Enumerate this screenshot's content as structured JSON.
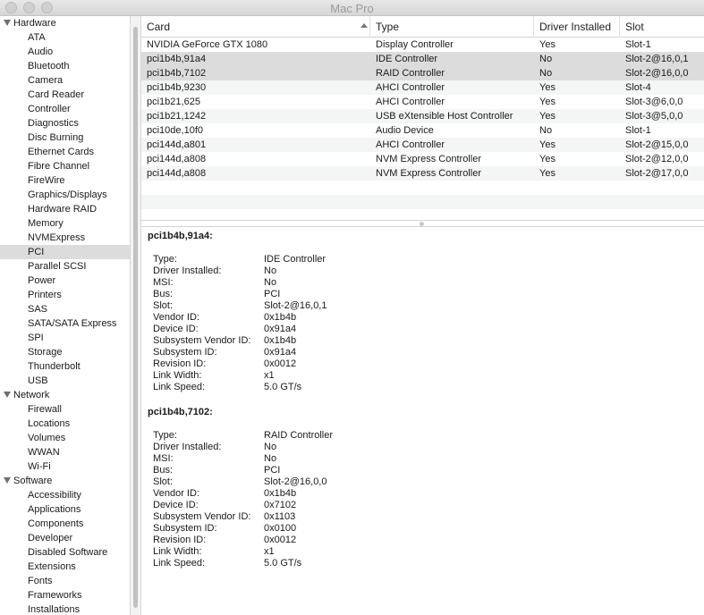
{
  "window": {
    "title": "Mac Pro"
  },
  "sidebar": {
    "groups": [
      {
        "label": "Hardware",
        "items": [
          "ATA",
          "Audio",
          "Bluetooth",
          "Camera",
          "Card Reader",
          "Controller",
          "Diagnostics",
          "Disc Burning",
          "Ethernet Cards",
          "Fibre Channel",
          "FireWire",
          "Graphics/Displays",
          "Hardware RAID",
          "Memory",
          "NVMExpress",
          "PCI",
          "Parallel SCSI",
          "Power",
          "Printers",
          "SAS",
          "SATA/SATA Express",
          "SPI",
          "Storage",
          "Thunderbolt",
          "USB"
        ]
      },
      {
        "label": "Network",
        "items": [
          "Firewall",
          "Locations",
          "Volumes",
          "WWAN",
          "Wi-Fi"
        ]
      },
      {
        "label": "Software",
        "items": [
          "Accessibility",
          "Applications",
          "Components",
          "Developer",
          "Disabled Software",
          "Extensions",
          "Fonts",
          "Frameworks",
          "Installations"
        ]
      }
    ],
    "selected": "PCI"
  },
  "table": {
    "headers": [
      "Card",
      "Type",
      "Driver Installed",
      "Slot"
    ],
    "rows": [
      [
        "NVIDIA GeForce GTX 1080",
        "Display Controller",
        "Yes",
        "Slot-1"
      ],
      [
        "pci1b4b,91a4",
        "IDE Controller",
        "No",
        "Slot-2@16,0,1"
      ],
      [
        "pci1b4b,7102",
        "RAID Controller",
        "No",
        "Slot-2@16,0,0"
      ],
      [
        "pci1b4b,9230",
        "AHCI Controller",
        "Yes",
        "Slot-4"
      ],
      [
        "pci1b21,625",
        "AHCI Controller",
        "Yes",
        "Slot-3@6,0,0"
      ],
      [
        "pci1b21,1242",
        "USB eXtensible Host Controller",
        "Yes",
        "Slot-3@5,0,0"
      ],
      [
        "pci10de,10f0",
        "Audio Device",
        "No",
        "Slot-1"
      ],
      [
        "pci144d,a801",
        "AHCI Controller",
        "Yes",
        "Slot-2@15,0,0"
      ],
      [
        "pci144d,a808",
        "NVM Express Controller",
        "Yes",
        "Slot-2@12,0,0"
      ],
      [
        "pci144d,a808",
        "NVM Express Controller",
        "Yes",
        "Slot-2@17,0,0"
      ]
    ],
    "selected_rows": [
      1,
      2
    ]
  },
  "details": [
    {
      "title": "pci1b4b,91a4:",
      "props": [
        [
          "Type:",
          "IDE Controller"
        ],
        [
          "Driver Installed:",
          "No"
        ],
        [
          "MSI:",
          "No"
        ],
        [
          "Bus:",
          "PCI"
        ],
        [
          "Slot:",
          "Slot-2@16,0,1"
        ],
        [
          "Vendor ID:",
          "0x1b4b"
        ],
        [
          "Device ID:",
          "0x91a4"
        ],
        [
          "Subsystem Vendor ID:",
          "0x1b4b"
        ],
        [
          "Subsystem ID:",
          "0x91a4"
        ],
        [
          "Revision ID:",
          "0x0012"
        ],
        [
          "Link Width:",
          "x1"
        ],
        [
          "Link Speed:",
          "5.0 GT/s"
        ]
      ]
    },
    {
      "title": "pci1b4b,7102:",
      "props": [
        [
          "Type:",
          "RAID Controller"
        ],
        [
          "Driver Installed:",
          "No"
        ],
        [
          "MSI:",
          "No"
        ],
        [
          "Bus:",
          "PCI"
        ],
        [
          "Slot:",
          "Slot-2@16,0,0"
        ],
        [
          "Vendor ID:",
          "0x1b4b"
        ],
        [
          "Device ID:",
          "0x7102"
        ],
        [
          "Subsystem Vendor ID:",
          "0x1103"
        ],
        [
          "Subsystem ID:",
          "0x0100"
        ],
        [
          "Revision ID:",
          "0x0012"
        ],
        [
          "Link Width:",
          "x1"
        ],
        [
          "Link Speed:",
          "5.0 GT/s"
        ]
      ]
    }
  ]
}
